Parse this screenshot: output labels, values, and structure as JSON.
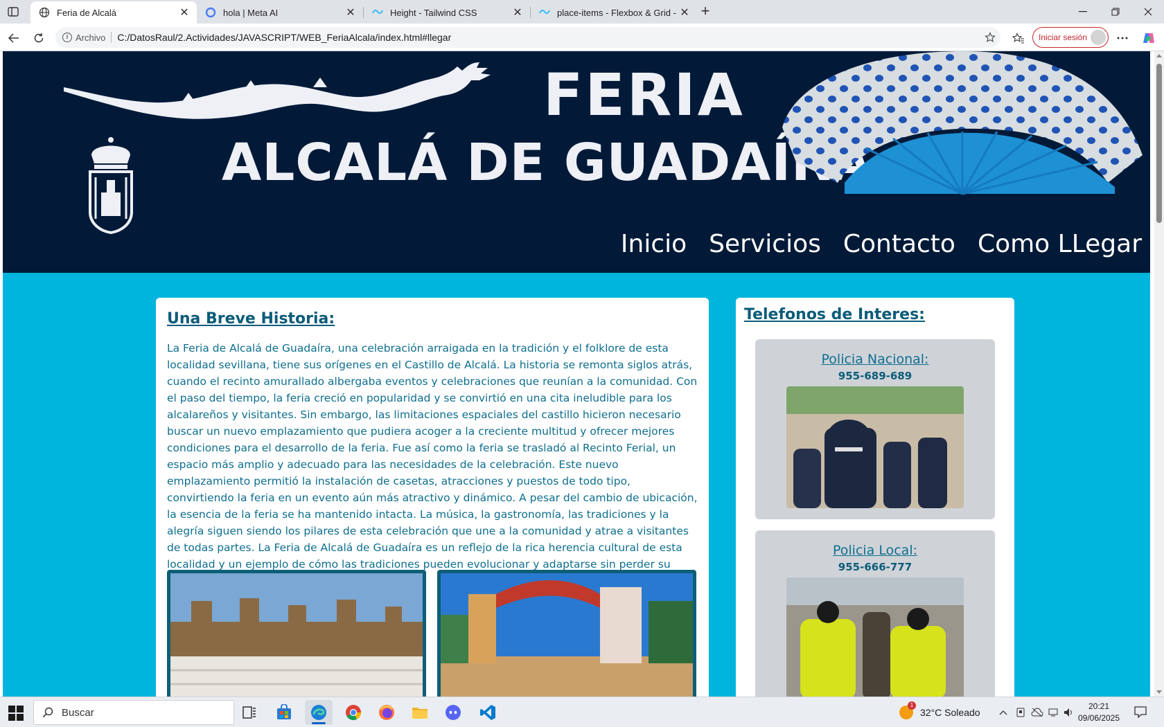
{
  "browser": {
    "tabs": [
      {
        "title": "Feria de Alcalá",
        "icon": "globe-icon",
        "active": true
      },
      {
        "title": "hola | Meta AI",
        "icon": "meta-ai-icon",
        "active": false
      },
      {
        "title": "Height - Tailwind CSS",
        "icon": "tailwind-icon",
        "active": false
      },
      {
        "title": "place-items - Flexbox & Grid - Tai",
        "icon": "tailwind-icon",
        "active": false
      }
    ],
    "address": {
      "scheme_label": "Archivo",
      "url": "C:/DatosRaul/2.Actividades/JAVASCRIPT/WEB_FeriaAlcala/index.html#llegar"
    },
    "signin_label": "Iniciar sesión"
  },
  "site": {
    "header": {
      "title_line1": "FERIA",
      "title_line2": "ALCALÁ DE GUADAÍRA"
    },
    "nav": [
      "Inicio",
      "Servicios",
      "Contacto",
      "Como LLegar"
    ],
    "history": {
      "heading": "Una Breve Historia:",
      "text": "La Feria de Alcalá de Guadaíra, una celebración arraigada en la tradición y el folklore de esta localidad sevillana, tiene sus orígenes en el Castillo de Alcalá. La historia se remonta siglos atrás, cuando el recinto amurallado albergaba eventos y celebraciones que reunían a la comunidad. Con el paso del tiempo, la feria creció en popularidad y se convirtió en una cita ineludible para los alcalareños y visitantes. Sin embargo, las limitaciones espaciales del castillo hicieron necesario buscar un nuevo emplazamiento que pudiera acoger a la creciente multitud y ofrecer mejores condiciones para el desarrollo de la feria. Fue así como la feria se trasladó al Recinto Ferial, un espacio más amplio y adecuado para las necesidades de la celebración. Este nuevo emplazamiento permitió la instalación de casetas, atracciones y puestos de todo tipo, convirtiendo la feria en un evento aún más atractivo y dinámico. A pesar del cambio de ubicación, la esencia de la feria se ha mantenido intacta. La música, la gastronomía, las tradiciones y la alegría siguen siendo los pilares de esta celebración que une a la comunidad y atrae a visitantes de todas partes. La Feria de Alcalá de Guadaíra es un reflejo de la rica herencia cultural de esta localidad y un ejemplo de cómo las tradiciones pueden evolucionar y adaptarse sin perder su esencia."
    },
    "phones": {
      "heading": "Telefonos de Interes:",
      "items": [
        {
          "name": "Policia Nacional:",
          "number": "955-689-689"
        },
        {
          "name": "Policia Local:",
          "number": "955-666-777"
        }
      ]
    }
  },
  "taskbar": {
    "search_placeholder": "Buscar",
    "weather": "32°C  Soleado",
    "time": "20:21",
    "date": "09/06/2025"
  },
  "colors": {
    "header_bg": "#021a38",
    "page_bg": "#00b5dd",
    "heading": "#0b5c79",
    "body_text": "#0e6e8e",
    "signin": "#c4262e"
  }
}
